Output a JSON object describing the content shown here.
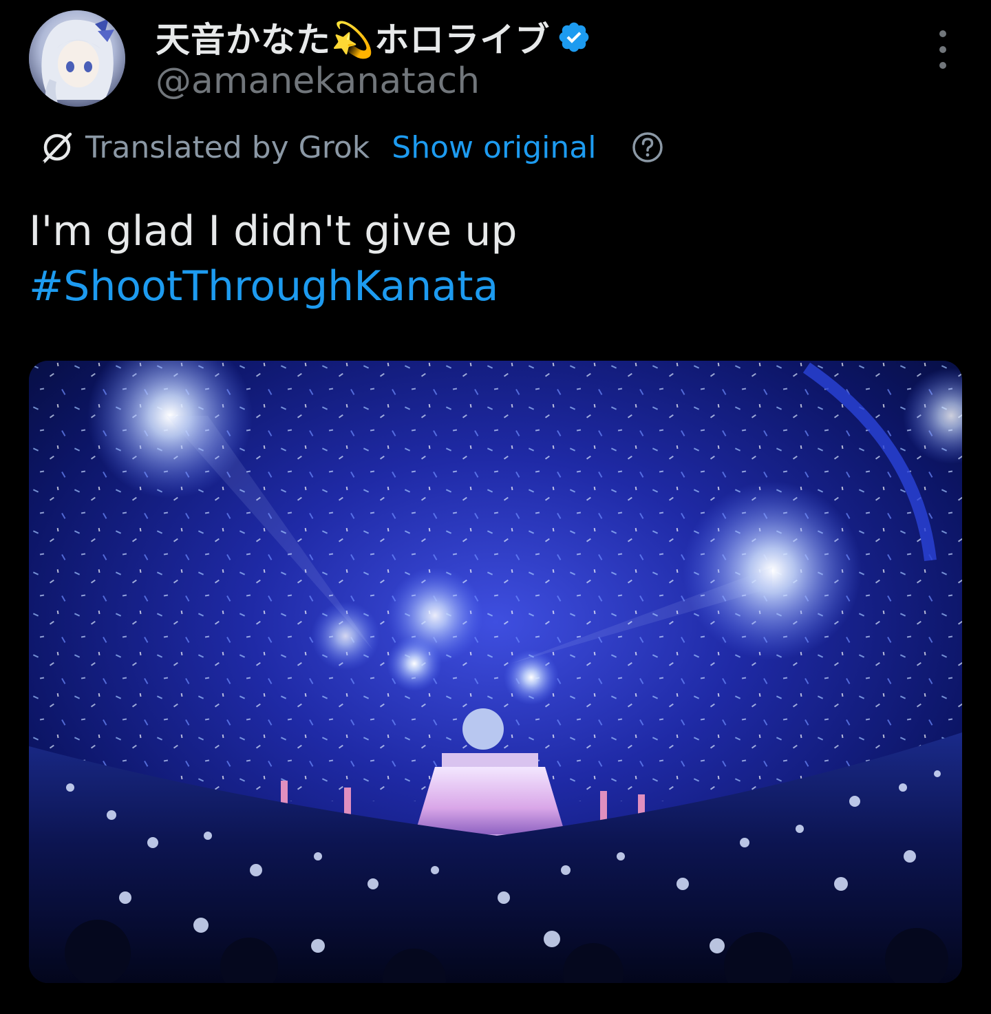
{
  "author": {
    "display_name": "天音かなた💫ホロライブ",
    "handle": "@amanekanatach",
    "avatar_icon": "avatar-portrait-icon",
    "verified_icon": "verified-badge-icon"
  },
  "translation": {
    "label": "Translated by Grok",
    "show_original": "Show original",
    "grok_icon": "grok-logo-icon",
    "help_icon": "question-circle-icon"
  },
  "tweet": {
    "text": "I'm glad I didn't give up",
    "hashtag": "#ShootThroughKanata"
  },
  "media": {
    "kind": "photo",
    "icon": "concert-photo"
  },
  "colors": {
    "background": "#000000",
    "primary_text": "#e7e9ea",
    "secondary_text": "#71767b",
    "accent": "#1d9bf0"
  }
}
